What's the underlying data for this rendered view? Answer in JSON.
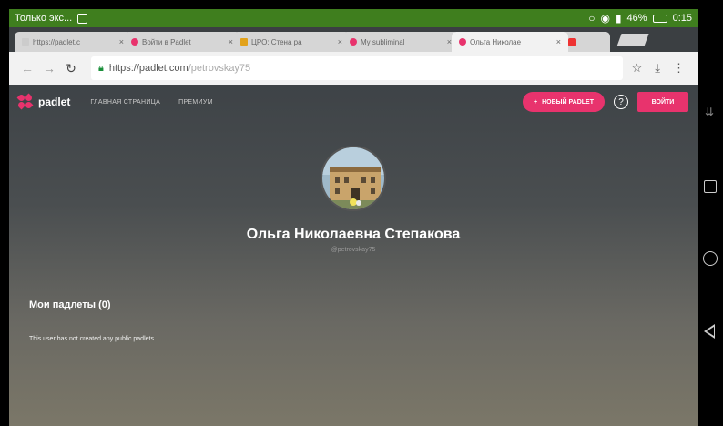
{
  "status_bar": {
    "app_label": "Только экс...",
    "battery_percent": "46%",
    "time": "0:15"
  },
  "tabs": [
    {
      "title": "https://padlet.c",
      "active": false
    },
    {
      "title": "Войти в Padlet",
      "active": false
    },
    {
      "title": "ЦРО: Стена ра",
      "active": false
    },
    {
      "title": "My subliminal",
      "active": false
    },
    {
      "title": "Ольга Николае",
      "active": true
    },
    {
      "title": "",
      "active": false
    }
  ],
  "address": {
    "url_main": "https://padlet.com",
    "url_path": "/petrovskay75"
  },
  "padlet": {
    "logo_text": "padlet",
    "nav": [
      "ГЛАВНАЯ СТРАНИЦА",
      "ПРЕМИУМ"
    ],
    "new_button": "НОВЫЙ PADLET",
    "help_label": "?",
    "login_button": "ВОЙТИ"
  },
  "profile": {
    "name": "Ольга Николаевна Степакова",
    "handle": "@petrovskay75"
  },
  "section": {
    "title": "Мои падлеты (0)",
    "empty_message": "This user has not created any public padlets."
  },
  "colors": {
    "accent": "#e8336d",
    "status_bar": "#3f7e1e"
  }
}
